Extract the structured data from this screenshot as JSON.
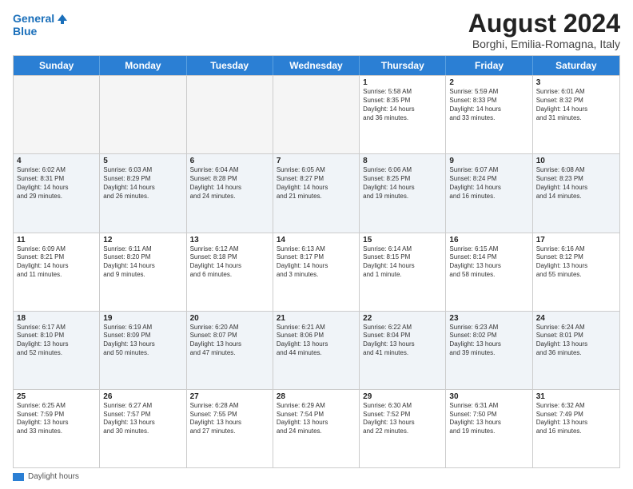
{
  "logo": {
    "line1": "General",
    "line2": "Blue"
  },
  "title": "August 2024",
  "subtitle": "Borghi, Emilia-Romagna, Italy",
  "header_days": [
    "Sunday",
    "Monday",
    "Tuesday",
    "Wednesday",
    "Thursday",
    "Friday",
    "Saturday"
  ],
  "footer_label": "Daylight hours",
  "weeks": [
    [
      {
        "day": "",
        "text": "",
        "empty": true
      },
      {
        "day": "",
        "text": "",
        "empty": true
      },
      {
        "day": "",
        "text": "",
        "empty": true
      },
      {
        "day": "",
        "text": "",
        "empty": true
      },
      {
        "day": "1",
        "text": "Sunrise: 5:58 AM\nSunset: 8:35 PM\nDaylight: 14 hours\nand 36 minutes."
      },
      {
        "day": "2",
        "text": "Sunrise: 5:59 AM\nSunset: 8:33 PM\nDaylight: 14 hours\nand 33 minutes."
      },
      {
        "day": "3",
        "text": "Sunrise: 6:01 AM\nSunset: 8:32 PM\nDaylight: 14 hours\nand 31 minutes."
      }
    ],
    [
      {
        "day": "4",
        "text": "Sunrise: 6:02 AM\nSunset: 8:31 PM\nDaylight: 14 hours\nand 29 minutes."
      },
      {
        "day": "5",
        "text": "Sunrise: 6:03 AM\nSunset: 8:29 PM\nDaylight: 14 hours\nand 26 minutes."
      },
      {
        "day": "6",
        "text": "Sunrise: 6:04 AM\nSunset: 8:28 PM\nDaylight: 14 hours\nand 24 minutes."
      },
      {
        "day": "7",
        "text": "Sunrise: 6:05 AM\nSunset: 8:27 PM\nDaylight: 14 hours\nand 21 minutes."
      },
      {
        "day": "8",
        "text": "Sunrise: 6:06 AM\nSunset: 8:25 PM\nDaylight: 14 hours\nand 19 minutes."
      },
      {
        "day": "9",
        "text": "Sunrise: 6:07 AM\nSunset: 8:24 PM\nDaylight: 14 hours\nand 16 minutes."
      },
      {
        "day": "10",
        "text": "Sunrise: 6:08 AM\nSunset: 8:23 PM\nDaylight: 14 hours\nand 14 minutes."
      }
    ],
    [
      {
        "day": "11",
        "text": "Sunrise: 6:09 AM\nSunset: 8:21 PM\nDaylight: 14 hours\nand 11 minutes."
      },
      {
        "day": "12",
        "text": "Sunrise: 6:11 AM\nSunset: 8:20 PM\nDaylight: 14 hours\nand 9 minutes."
      },
      {
        "day": "13",
        "text": "Sunrise: 6:12 AM\nSunset: 8:18 PM\nDaylight: 14 hours\nand 6 minutes."
      },
      {
        "day": "14",
        "text": "Sunrise: 6:13 AM\nSunset: 8:17 PM\nDaylight: 14 hours\nand 3 minutes."
      },
      {
        "day": "15",
        "text": "Sunrise: 6:14 AM\nSunset: 8:15 PM\nDaylight: 14 hours\nand 1 minute."
      },
      {
        "day": "16",
        "text": "Sunrise: 6:15 AM\nSunset: 8:14 PM\nDaylight: 13 hours\nand 58 minutes."
      },
      {
        "day": "17",
        "text": "Sunrise: 6:16 AM\nSunset: 8:12 PM\nDaylight: 13 hours\nand 55 minutes."
      }
    ],
    [
      {
        "day": "18",
        "text": "Sunrise: 6:17 AM\nSunset: 8:10 PM\nDaylight: 13 hours\nand 52 minutes."
      },
      {
        "day": "19",
        "text": "Sunrise: 6:19 AM\nSunset: 8:09 PM\nDaylight: 13 hours\nand 50 minutes."
      },
      {
        "day": "20",
        "text": "Sunrise: 6:20 AM\nSunset: 8:07 PM\nDaylight: 13 hours\nand 47 minutes."
      },
      {
        "day": "21",
        "text": "Sunrise: 6:21 AM\nSunset: 8:06 PM\nDaylight: 13 hours\nand 44 minutes."
      },
      {
        "day": "22",
        "text": "Sunrise: 6:22 AM\nSunset: 8:04 PM\nDaylight: 13 hours\nand 41 minutes."
      },
      {
        "day": "23",
        "text": "Sunrise: 6:23 AM\nSunset: 8:02 PM\nDaylight: 13 hours\nand 39 minutes."
      },
      {
        "day": "24",
        "text": "Sunrise: 6:24 AM\nSunset: 8:01 PM\nDaylight: 13 hours\nand 36 minutes."
      }
    ],
    [
      {
        "day": "25",
        "text": "Sunrise: 6:25 AM\nSunset: 7:59 PM\nDaylight: 13 hours\nand 33 minutes."
      },
      {
        "day": "26",
        "text": "Sunrise: 6:27 AM\nSunset: 7:57 PM\nDaylight: 13 hours\nand 30 minutes."
      },
      {
        "day": "27",
        "text": "Sunrise: 6:28 AM\nSunset: 7:55 PM\nDaylight: 13 hours\nand 27 minutes."
      },
      {
        "day": "28",
        "text": "Sunrise: 6:29 AM\nSunset: 7:54 PM\nDaylight: 13 hours\nand 24 minutes."
      },
      {
        "day": "29",
        "text": "Sunrise: 6:30 AM\nSunset: 7:52 PM\nDaylight: 13 hours\nand 22 minutes."
      },
      {
        "day": "30",
        "text": "Sunrise: 6:31 AM\nSunset: 7:50 PM\nDaylight: 13 hours\nand 19 minutes."
      },
      {
        "day": "31",
        "text": "Sunrise: 6:32 AM\nSunset: 7:49 PM\nDaylight: 13 hours\nand 16 minutes."
      }
    ]
  ]
}
